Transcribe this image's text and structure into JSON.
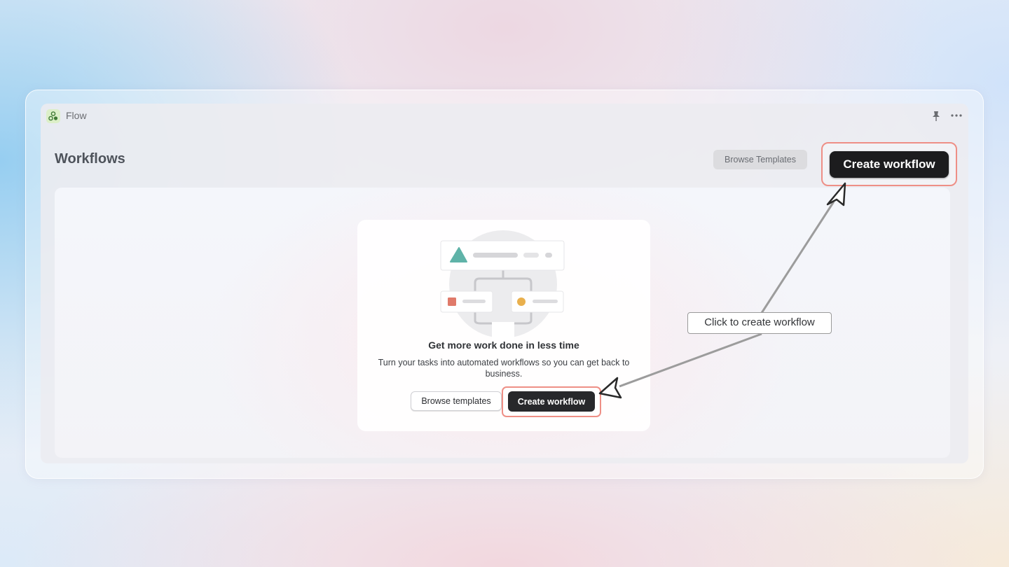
{
  "window": {
    "app_name": "Flow",
    "icons": {
      "app_logo": "flow-logo-icon",
      "pin": "pin-icon",
      "more": "more-horizontal-icon"
    }
  },
  "header": {
    "title": "Workflows",
    "browse_templates_label": "Browse Templates",
    "create_workflow_label": "Create workflow"
  },
  "empty_state": {
    "heading": "Get more work done in less time",
    "description": "Turn your tasks into automated workflows so you can get back to business.",
    "browse_templates_label": "Browse templates",
    "create_workflow_label": "Create workflow"
  },
  "annotation": {
    "callout_text": "Click to create workflow",
    "highlight_color": "#ee8f86"
  },
  "colors": {
    "primary_button": "#1c1c1e",
    "illustration_triangle": "#5fb3a8",
    "illustration_square": "#e07a6a",
    "illustration_circle": "#e9b04d"
  }
}
